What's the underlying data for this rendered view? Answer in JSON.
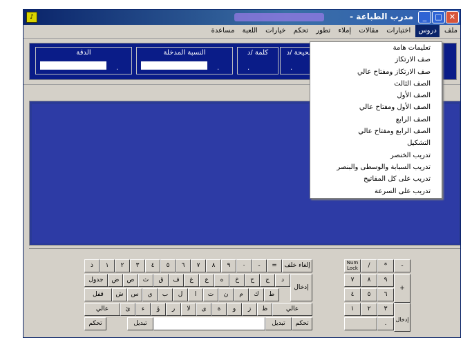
{
  "window": {
    "title": "مدرب الطباعة -",
    "controls": {
      "minimize": "_",
      "maximize": "□",
      "close": "✕"
    },
    "icon": "typing-trainer-icon"
  },
  "menu": [
    "ملف",
    "دروس",
    "اختبارات",
    "مقالات",
    "إملاء",
    "تطور",
    "تحكم",
    "خيارات",
    "اللعبة",
    "مساعدة"
  ],
  "stats": {
    "accuracy": {
      "label": "الدقة",
      "value": "."
    },
    "entered": {
      "label": "النسبة المدخلة",
      "value": "."
    },
    "words": {
      "label": "كلمة /د",
      "value": "."
    },
    "correct": {
      "label": "صحيحة /د",
      "value": "."
    }
  },
  "lessons_menu": [
    "تعليمات هامة",
    "صف الارتكاز",
    "صف الارتكاز ومفتاح عالي",
    "الصف الثالث",
    "الصف الأول",
    "الصف الأول ومفتاح عالي",
    "الصف الرابع",
    "الصف الرابع ومفتاح عالي",
    "التشكيل",
    "تدريب الخنصر",
    "تدريب السبابة والوسطى والبنصر",
    "تدريب على كل المفاتيح",
    "تدريب على السرعة"
  ],
  "keyboard": {
    "row1": [
      "ذ",
      "١",
      "٢",
      "٣",
      "٤",
      "٥",
      "٦",
      "٧",
      "٨",
      "٩",
      "٠",
      "-",
      "="
    ],
    "backspace": "إلغاء خلف",
    "tab": "جدول",
    "row2": [
      "ض",
      "ص",
      "ث",
      "ق",
      "ف",
      "غ",
      "ع",
      "ه",
      "خ",
      "ح",
      "ج",
      "د"
    ],
    "enter": "إدخال",
    "capslock": "قفل مفاتيح",
    "row3": [
      "ش",
      "س",
      "ي",
      "ب",
      "ل",
      "ا",
      "ت",
      "ن",
      "م",
      "ك",
      "ط"
    ],
    "shift_left": "عالي",
    "shift_right": "عالي",
    "row4": [
      "ئ",
      "ء",
      "ؤ",
      "ر",
      "لا",
      "ى",
      "ة",
      "و",
      "ز",
      "ظ"
    ],
    "ctrl_left": "تحكم",
    "alt_left": "تبديل",
    "ctrl_right": "تحكم",
    "alt_right": "تبديل",
    "numpad": {
      "numlock": "Num Lock",
      "row1": [
        "/",
        "*",
        "-"
      ],
      "row2": [
        "٧",
        "٨",
        "٩"
      ],
      "row3": [
        "٤",
        "٥",
        "٦"
      ],
      "row4": [
        "١",
        "٢",
        "٣"
      ],
      "plus": "+",
      "enter": "إدخال",
      "dot": "."
    }
  }
}
